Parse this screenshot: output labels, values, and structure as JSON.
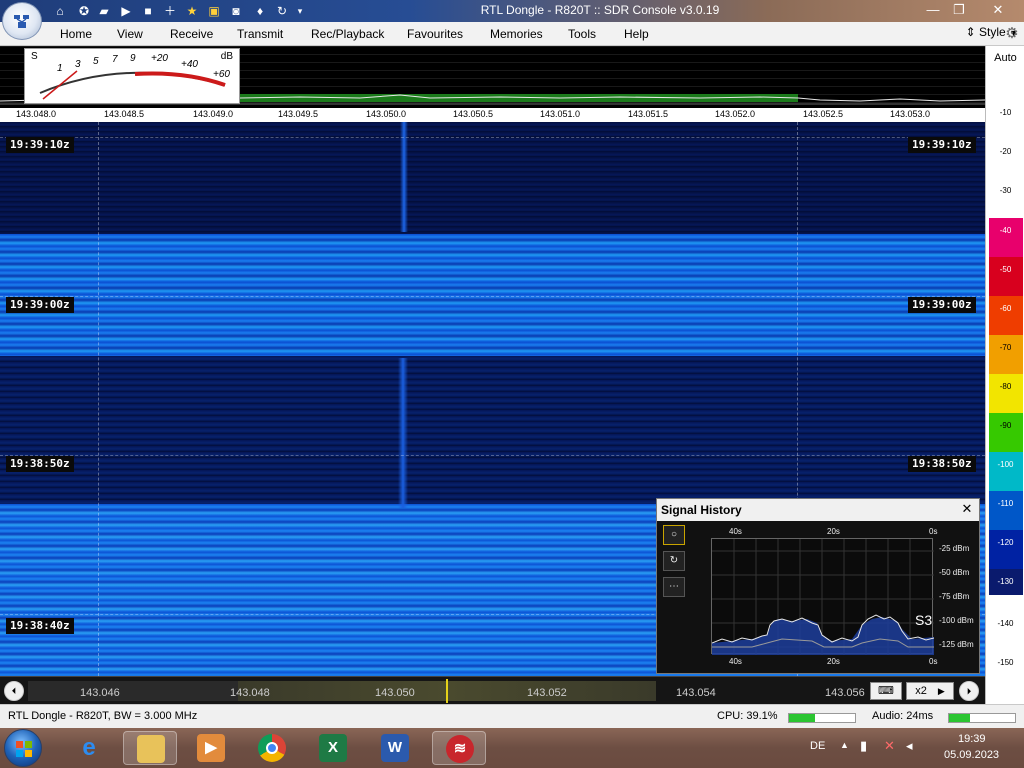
{
  "window": {
    "title": "RTL Dongle - R820T :: SDR Console v3.0.19",
    "minimize_icon": "minimize-icon",
    "maximize_icon": "maximize-icon",
    "close_icon": "close-icon"
  },
  "menu": {
    "items": [
      "Home",
      "View",
      "Receive",
      "Transmit",
      "Rec/Playback",
      "Favourites",
      "Memories",
      "Tools",
      "Help"
    ],
    "style_label": "Style"
  },
  "smeter": {
    "unit_left": "S",
    "unit_right": "dB",
    "scale": [
      "1",
      "3",
      "5",
      "7",
      "9",
      "+20",
      "+40",
      "+60"
    ]
  },
  "spectrum": {
    "freq_labels": [
      "143.048.0",
      "143.048.5",
      "143.049.0",
      "143.049.5",
      "143.050.0",
      "143.050.5",
      "143.051.0",
      "143.051.5",
      "143.052.0",
      "143.052.5",
      "143.053.0"
    ]
  },
  "db_scale": {
    "auto_label": "Auto",
    "labels": [
      "-10",
      "-20",
      "-30",
      "-40",
      "-50",
      "-60",
      "-70",
      "-80",
      "-90",
      "-100",
      "-110",
      "-120",
      "-130",
      "-140",
      "-150"
    ],
    "colors": {
      "-40": "#e8006c",
      "-50": "#d8001e",
      "-60": "#ef3d00",
      "-70": "#f19f00",
      "-80": "#f2e500",
      "-90": "#36c900",
      "-100": "#00b9c8",
      "-110": "#0057c8",
      "-120": "#0022a3",
      "-130": "#0a1a6d"
    }
  },
  "waterfall": {
    "timestamps": [
      "19:39:10z",
      "19:39:00z",
      "19:38:50z",
      "19:38:40z"
    ]
  },
  "signal_history": {
    "title": "Signal History",
    "top_axis": [
      "40s",
      "20s",
      "0s"
    ],
    "bottom_axis": [
      "40s",
      "20s",
      "0s"
    ],
    "y_axis": [
      "-25 dBm",
      "-50 dBm",
      "-75 dBm",
      "-100 dBm",
      "-125 dBm"
    ],
    "s_reading": "S3",
    "buttons": [
      "circle-icon",
      "refresh-icon",
      "more-icon"
    ]
  },
  "bottom_freq": {
    "labels": [
      "143.046",
      "143.048",
      "143.050",
      "143.052",
      "143.054",
      "143.056"
    ],
    "zoom_label": "x2"
  },
  "status": {
    "device": "RTL Dongle - R820T, BW = 3.000 MHz",
    "cpu": "CPU: 39.1%",
    "audio": "Audio: 24ms",
    "cpu_level": 0.391
  },
  "taskbar": {
    "apps": [
      "internet-explorer-icon",
      "file-explorer-icon",
      "media-player-icon",
      "chrome-icon",
      "excel-icon",
      "word-icon",
      "sdr-console-icon"
    ],
    "language": "DE",
    "time": "19:39",
    "date": "05.09.2023"
  }
}
